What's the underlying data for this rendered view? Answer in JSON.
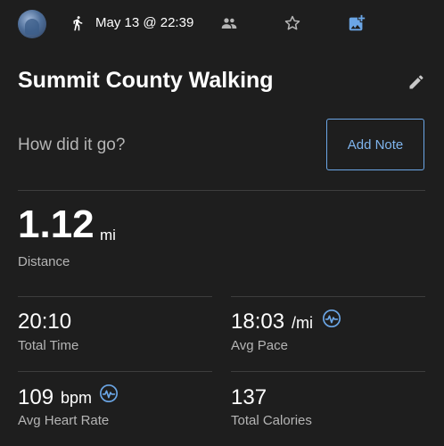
{
  "header": {
    "date": "May 13 @ 22:39",
    "icons": [
      "avatar",
      "walk-icon",
      "people-icon",
      "star-icon",
      "add-photo-icon"
    ]
  },
  "activity": {
    "title": "Summit County Walking"
  },
  "note": {
    "prompt": "How did it go?",
    "button_label": "Add Note"
  },
  "distance": {
    "value": "1.12",
    "unit": "mi",
    "label": "Distance"
  },
  "stats": {
    "total_time": {
      "value": "20:10",
      "label": "Total Time"
    },
    "avg_pace": {
      "value": "18:03",
      "unit": "/mi",
      "label": "Avg Pace"
    },
    "avg_heart_rate": {
      "value": "109",
      "unit": "bpm",
      "label": "Avg Heart Rate"
    },
    "total_calories": {
      "value": "137",
      "label": "Total Calories"
    }
  },
  "colors": {
    "background": "#1e1e1e",
    "accent": "#6ba6e6",
    "secondary_text": "#b5b5b5"
  }
}
